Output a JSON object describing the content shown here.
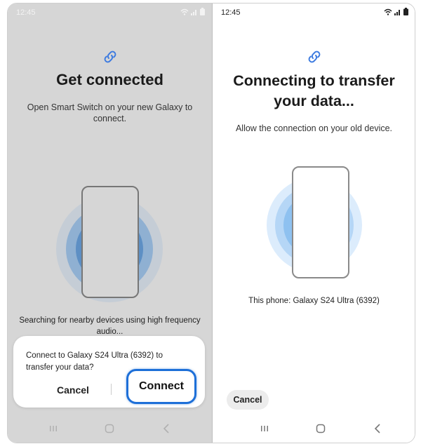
{
  "left": {
    "status": {
      "time": "12:45"
    },
    "title": "Get connected",
    "subtitle": "Open Smart Switch on your new Galaxy to connect.",
    "searching": "Searching for nearby devices using high frequency audio...",
    "dialog": {
      "message": "Connect to Galaxy S24 Ultra (6392) to transfer your data?",
      "cancel_label": "Cancel",
      "connect_label": "Connect",
      "accent": "#1d6fd8"
    }
  },
  "right": {
    "status": {
      "time": "12:45"
    },
    "title": "Connecting to transfer your data...",
    "subtitle": "Allow the connection on your old device.",
    "this_phone": "This phone: Galaxy S24 Ultra (6392)",
    "cancel_label": "Cancel"
  },
  "icons": {
    "link": "link-icon",
    "wifi": "wifi-icon",
    "signal": "signal-icon",
    "battery": "battery-icon",
    "recents": "recents-icon",
    "home": "home-icon",
    "back": "back-icon"
  },
  "colors": {
    "link_blue": "#3d7be0",
    "ring_blue": "#6aaef0"
  }
}
